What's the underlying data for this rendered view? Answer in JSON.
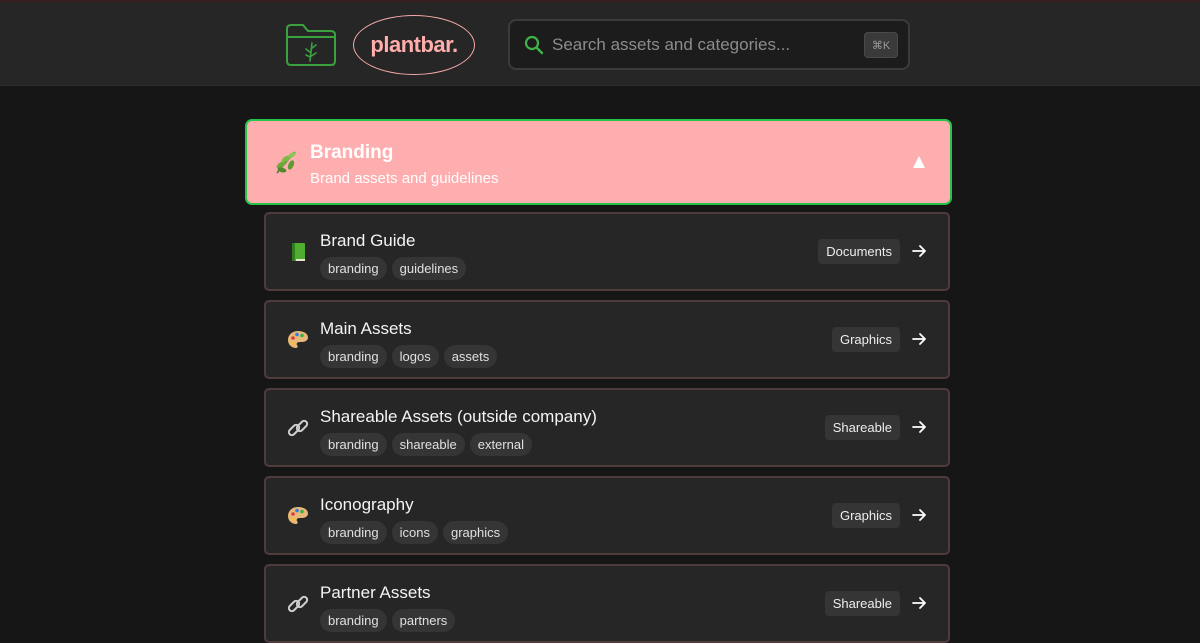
{
  "header": {
    "logo_icon": "folder-plant-icon",
    "brand": "plantbar.",
    "search_placeholder": "Search assets and categories...",
    "search_shortcut": "⌘K"
  },
  "category": {
    "icon": "leaf-icon",
    "title": "Branding",
    "subtitle": "Brand assets and guidelines",
    "expanded": true
  },
  "items": [
    {
      "icon": "book-icon",
      "title": "Brand Guide",
      "tags": [
        "branding",
        "guidelines"
      ],
      "type": "Documents"
    },
    {
      "icon": "palette-icon",
      "title": "Main Assets",
      "tags": [
        "branding",
        "logos",
        "assets"
      ],
      "type": "Graphics"
    },
    {
      "icon": "link-icon",
      "title": "Shareable Assets (outside company)",
      "tags": [
        "branding",
        "shareable",
        "external"
      ],
      "type": "Shareable"
    },
    {
      "icon": "palette-icon",
      "title": "Iconography",
      "tags": [
        "branding",
        "icons",
        "graphics"
      ],
      "type": "Graphics"
    },
    {
      "icon": "link-icon",
      "title": "Partner Assets",
      "tags": [
        "branding",
        "partners"
      ],
      "type": "Shareable"
    }
  ],
  "colors": {
    "accent_pink": "#ffaeaf",
    "accent_green": "#23c449",
    "background": "#161616",
    "card": "#262626"
  }
}
